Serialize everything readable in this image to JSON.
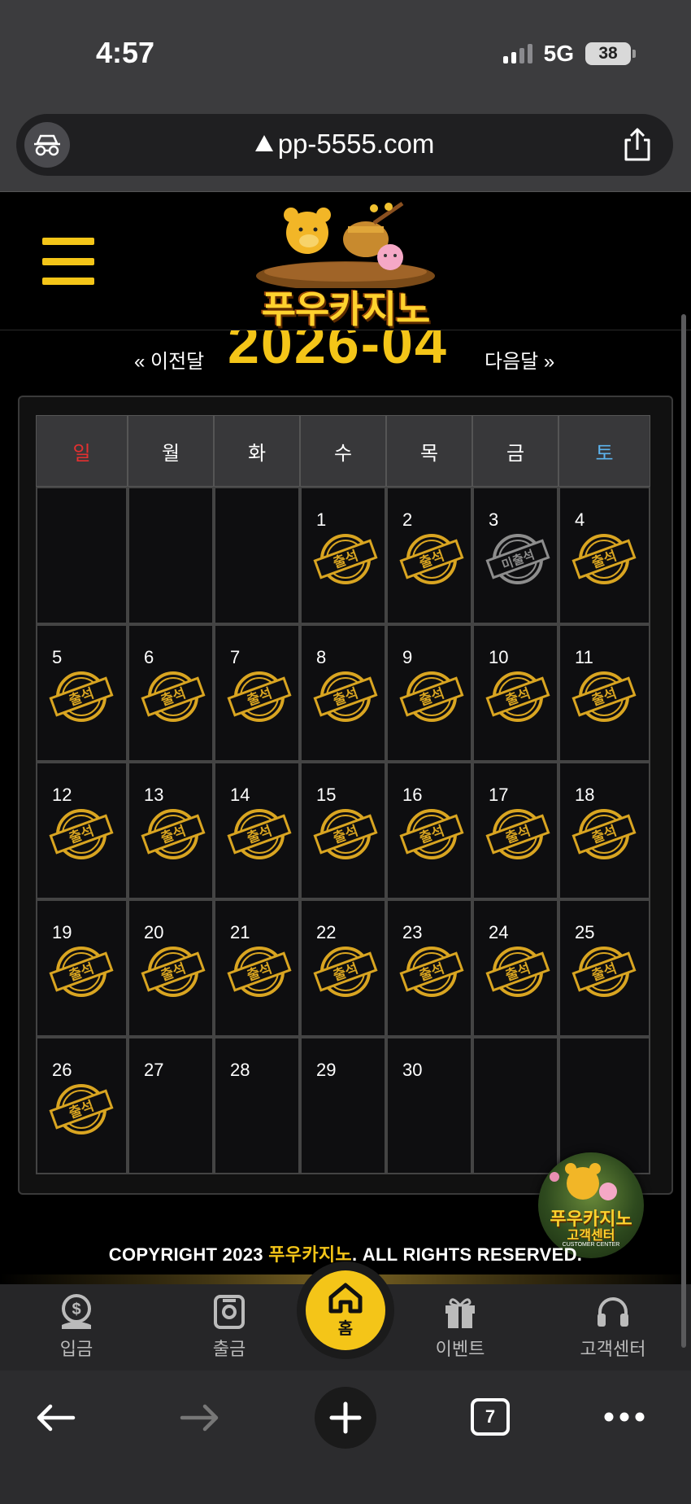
{
  "status_bar": {
    "time": "4:57",
    "network": "5G",
    "battery": "38"
  },
  "browser": {
    "url": "pp-5555.com"
  },
  "site": {
    "logo_text": "푸우카지노",
    "month_nav": {
      "prev_label": "« 이전달",
      "title": "2026-04",
      "next_label": "다음달 »"
    }
  },
  "calendar": {
    "weekdays": [
      "일",
      "월",
      "화",
      "수",
      "목",
      "금",
      "토"
    ],
    "weekday_colors": {
      "sunday": "#e53030",
      "saturday": "#5db4ee"
    },
    "stamp_attended": "출석",
    "stamp_missed": "미출석",
    "weeks": [
      [
        {
          "day": "",
          "stamp": ""
        },
        {
          "day": "",
          "stamp": ""
        },
        {
          "day": "",
          "stamp": ""
        },
        {
          "day": "1",
          "stamp": "attended"
        },
        {
          "day": "2",
          "stamp": "attended"
        },
        {
          "day": "3",
          "stamp": "missed"
        },
        {
          "day": "4",
          "stamp": "attended"
        }
      ],
      [
        {
          "day": "5",
          "stamp": "attended"
        },
        {
          "day": "6",
          "stamp": "attended"
        },
        {
          "day": "7",
          "stamp": "attended"
        },
        {
          "day": "8",
          "stamp": "attended"
        },
        {
          "day": "9",
          "stamp": "attended"
        },
        {
          "day": "10",
          "stamp": "attended"
        },
        {
          "day": "11",
          "stamp": "attended"
        }
      ],
      [
        {
          "day": "12",
          "stamp": "attended"
        },
        {
          "day": "13",
          "stamp": "attended"
        },
        {
          "day": "14",
          "stamp": "attended"
        },
        {
          "day": "15",
          "stamp": "attended"
        },
        {
          "day": "16",
          "stamp": "attended"
        },
        {
          "day": "17",
          "stamp": "attended"
        },
        {
          "day": "18",
          "stamp": "attended"
        }
      ],
      [
        {
          "day": "19",
          "stamp": "attended"
        },
        {
          "day": "20",
          "stamp": "attended"
        },
        {
          "day": "21",
          "stamp": "attended"
        },
        {
          "day": "22",
          "stamp": "attended"
        },
        {
          "day": "23",
          "stamp": "attended"
        },
        {
          "day": "24",
          "stamp": "attended"
        },
        {
          "day": "25",
          "stamp": "attended"
        }
      ],
      [
        {
          "day": "26",
          "stamp": "attended"
        },
        {
          "day": "27",
          "stamp": ""
        },
        {
          "day": "28",
          "stamp": ""
        },
        {
          "day": "29",
          "stamp": ""
        },
        {
          "day": "30",
          "stamp": ""
        },
        {
          "day": "",
          "stamp": ""
        },
        {
          "day": "",
          "stamp": ""
        }
      ]
    ]
  },
  "footer": {
    "copyright_prefix": "COPYRIGHT 2023 ",
    "copyright_brand": "푸우카지노",
    "copyright_suffix": ". ALL RIGHTS RESERVED."
  },
  "customer_center_badge": {
    "title": "푸우카지노",
    "subtitle": "고객센터",
    "english": "CUSTOMER CENTER"
  },
  "bottom_nav": {
    "deposit": "입금",
    "withdraw": "출금",
    "home": "홈",
    "event": "이벤트",
    "support": "고객센터"
  },
  "safari_toolbar": {
    "tab_count": "7"
  },
  "colors": {
    "accent": "#f4c518",
    "background": "#000000",
    "stamp_gold": "#d9a521",
    "stamp_gray": "#8d8d8d"
  }
}
